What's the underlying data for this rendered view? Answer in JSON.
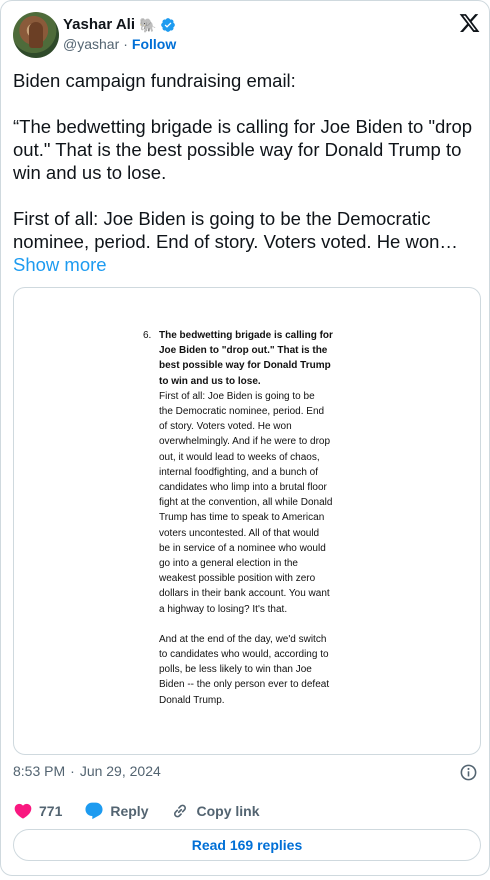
{
  "author": {
    "display_name": "Yashar Ali",
    "emoji": "🐘",
    "handle": "@yashar",
    "separator": "·",
    "follow_label": "Follow"
  },
  "tweet": {
    "text": "Biden campaign fundraising email:\n\n“The bedwetting brigade is calling for Joe Biden to \"drop out.\" That is the best possible way for Donald Trump to win and us to lose.\n\nFirst of all: Joe Biden is going to be the Democratic nominee, period. End of story. Voters voted. He won… ",
    "show_more": "Show more"
  },
  "media": {
    "item_number": "6.",
    "bold_lines": [
      "The bedwetting brigade is calling for",
      "Joe Biden to \"drop out.\" That is the",
      "best possible way for Donald Trump",
      "to win and us to lose."
    ],
    "para1_lines": [
      "First of all: Joe Biden is going to be",
      "the Democratic nominee, period. End",
      "of story. Voters voted. He won",
      "overwhelmingly. And if he were to drop",
      "out, it would lead to weeks of chaos,",
      "internal foodfighting, and a bunch of",
      "candidates who limp into a brutal floor",
      "fight at the convention, all while Donald",
      "Trump has time to speak to American",
      "voters uncontested. All of that would",
      "be in service of a nominee who would",
      "go into a general election in the",
      "weakest possible position with zero",
      "dollars in their bank account. You want",
      "a highway to losing? It's that."
    ],
    "para2_lines": [
      "And at the end of the day, we'd switch",
      "to candidates who would, according to",
      "polls, be less likely to win than Joe",
      "Biden -- the only person ever to defeat",
      "Donald Trump."
    ]
  },
  "meta": {
    "time": "8:53 PM",
    "separator": "·",
    "date": "Jun 29, 2024"
  },
  "actions": {
    "like_count": "771",
    "reply_label": "Reply",
    "copy_label": "Copy link"
  },
  "read_replies_label": "Read 169 replies",
  "colors": {
    "accent": "#1d9bf0",
    "link": "#006fd6",
    "like": "#f91880",
    "muted": "#536471"
  }
}
